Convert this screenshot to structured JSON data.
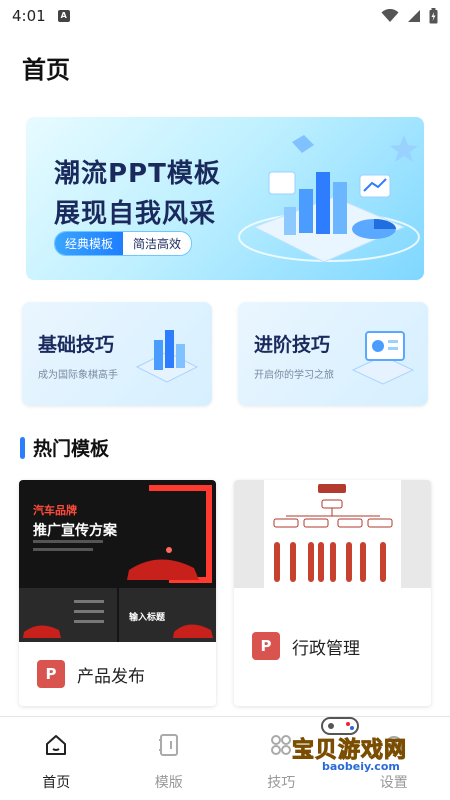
{
  "status_bar": {
    "time": "4:01",
    "a_icon": "A"
  },
  "page_title": "首页",
  "banner": {
    "line1": "潮流PPT模板",
    "line2": "展现自我风采",
    "tag_primary": "经典模板",
    "tag_secondary": "简洁高效"
  },
  "cards": [
    {
      "title": "基础技巧",
      "subtitle": "成为国际象棋高手"
    },
    {
      "title": "进阶技巧",
      "subtitle": "开启你的学习之旅"
    }
  ],
  "section": {
    "title": "热门模板"
  },
  "templates": [
    {
      "name": "产品发布",
      "thumb_title1": "汽车品牌",
      "thumb_title2": "推广宣传方案",
      "thumb_caption": "输入标题",
      "icon_letter": "P"
    },
    {
      "name": "行政管理",
      "icon_letter": "P"
    }
  ],
  "tabs": [
    {
      "label": "首页",
      "icon": "home-icon",
      "active": true
    },
    {
      "label": "模版",
      "icon": "template-icon",
      "active": false
    },
    {
      "label": "技巧",
      "icon": "tips-icon",
      "active": false
    },
    {
      "label": "设置",
      "icon": "settings-icon",
      "active": false
    }
  ],
  "watermark": {
    "text": "宝贝游戏网",
    "url": "baobeiy.com"
  },
  "colors": {
    "accent": "#2d7dff",
    "ppt_red": "#d9534f",
    "title_navy": "#1b2a5c",
    "red_accent": "#ff4b3a"
  }
}
